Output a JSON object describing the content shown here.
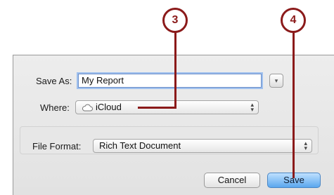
{
  "dialog": {
    "save_as_label": "Save As:",
    "filename_value": "My Report",
    "where_label": "Where:",
    "where_value": "iCloud",
    "file_format_label": "File Format:",
    "file_format_value": "Rich Text Document",
    "cancel_label": "Cancel",
    "save_label": "Save",
    "disclosure_glyph": "▾",
    "popup_arrows": "▴▾"
  },
  "callouts": {
    "where_number": "3",
    "save_number": "4"
  },
  "colors": {
    "callout": "#8b1a1a",
    "save_button": "#5aa7ee",
    "dialog_bg": "#e8e8e8"
  }
}
